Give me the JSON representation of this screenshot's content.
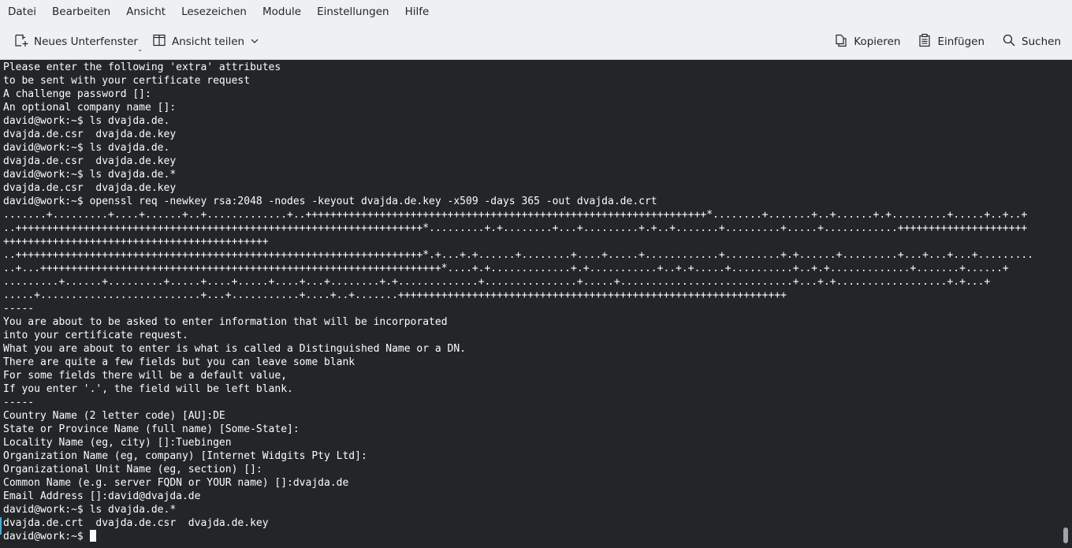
{
  "menubar": {
    "items": [
      "Datei",
      "Bearbeiten",
      "Ansicht",
      "Lesezeichen",
      "Module",
      "Einstellungen",
      "Hilfe"
    ]
  },
  "toolbar": {
    "new_tab_label": "Neues Unterfenster",
    "split_view_label": "Ansicht teilen",
    "copy_label": "Kopieren",
    "paste_label": "Einfügen",
    "search_label": "Suchen"
  },
  "terminal": {
    "lines": [
      "Please enter the following 'extra' attributes",
      "to be sent with your certificate request",
      "A challenge password []:",
      "An optional company name []:",
      "david@work:~$ ls dvajda.de.",
      "dvajda.de.csr  dvajda.de.key",
      "david@work:~$ ls dvajda.de.",
      "dvajda.de.csr  dvajda.de.key",
      "david@work:~$ ls dvajda.de.*",
      "dvajda.de.csr  dvajda.de.key",
      "david@work:~$ openssl req -newkey rsa:2048 -nodes -keyout dvajda.de.key -x509 -days 365 -out dvajda.de.crt",
      ".......+.........+....+......+..+.............+..+++++++++++++++++++++++++++++++++++++++++++++++++++++++++++++++++*........+.......+..+......+.+.........+.....+..+..+",
      "..++++++++++++++++++++++++++++++++++++++++++++++++++++++++++++++++++*.........+.+........+...+.........+.+..+.......+.........+.....+............+++++++++++++++++++++",
      "+++++++++++++++++++++++++++++++++++++++++++",
      "..++++++++++++++++++++++++++++++++++++++++++++++++++++++++++++++++++*.+...+.+......+........+....+.....+............+.........+.+......+.........+...+...+...+.........",
      "..+...+++++++++++++++++++++++++++++++++++++++++++++++++++++++++++++++++*....+.+.............+.+...........+..+.+.....+..........+..+.+.............+.......+......+",
      ".........+......+.........+.....+....+.....+....+...+........+.+.............+...............+.....+............................+...+.+..................+.+...+",
      ".....+..........................+...+...........+....+..+.......+++++++++++++++++++++++++++++++++++++++++++++++++++++++++++++++",
      "-----",
      "You are about to be asked to enter information that will be incorporated",
      "into your certificate request.",
      "What you are about to enter is what is called a Distinguished Name or a DN.",
      "There are quite a few fields but you can leave some blank",
      "For some fields there will be a default value,",
      "If you enter '.', the field will be left blank.",
      "-----",
      "Country Name (2 letter code) [AU]:DE",
      "State or Province Name (full name) [Some-State]:",
      "Locality Name (eg, city) []:Tuebingen",
      "Organization Name (eg, company) [Internet Widgits Pty Ltd]:",
      "Organizational Unit Name (eg, section) []:",
      "Common Name (e.g. server FQDN or YOUR name) []:dvajda.de",
      "Email Address []:david@dvajda.de",
      "david@work:~$ ls dvajda.de.*",
      "dvajda.de.crt  dvajda.de.csr  dvajda.de.key"
    ],
    "prompt": "david@work:~$ "
  },
  "colors": {
    "background": "#232629",
    "foreground": "#fcfcfc",
    "chrome": "#eff0f1",
    "accent": "#3daee9"
  },
  "icons": {
    "new_tab": "new-tab-icon",
    "split_view": "split-view-icon",
    "copy": "copy-icon",
    "paste": "paste-icon",
    "search": "search-icon"
  }
}
